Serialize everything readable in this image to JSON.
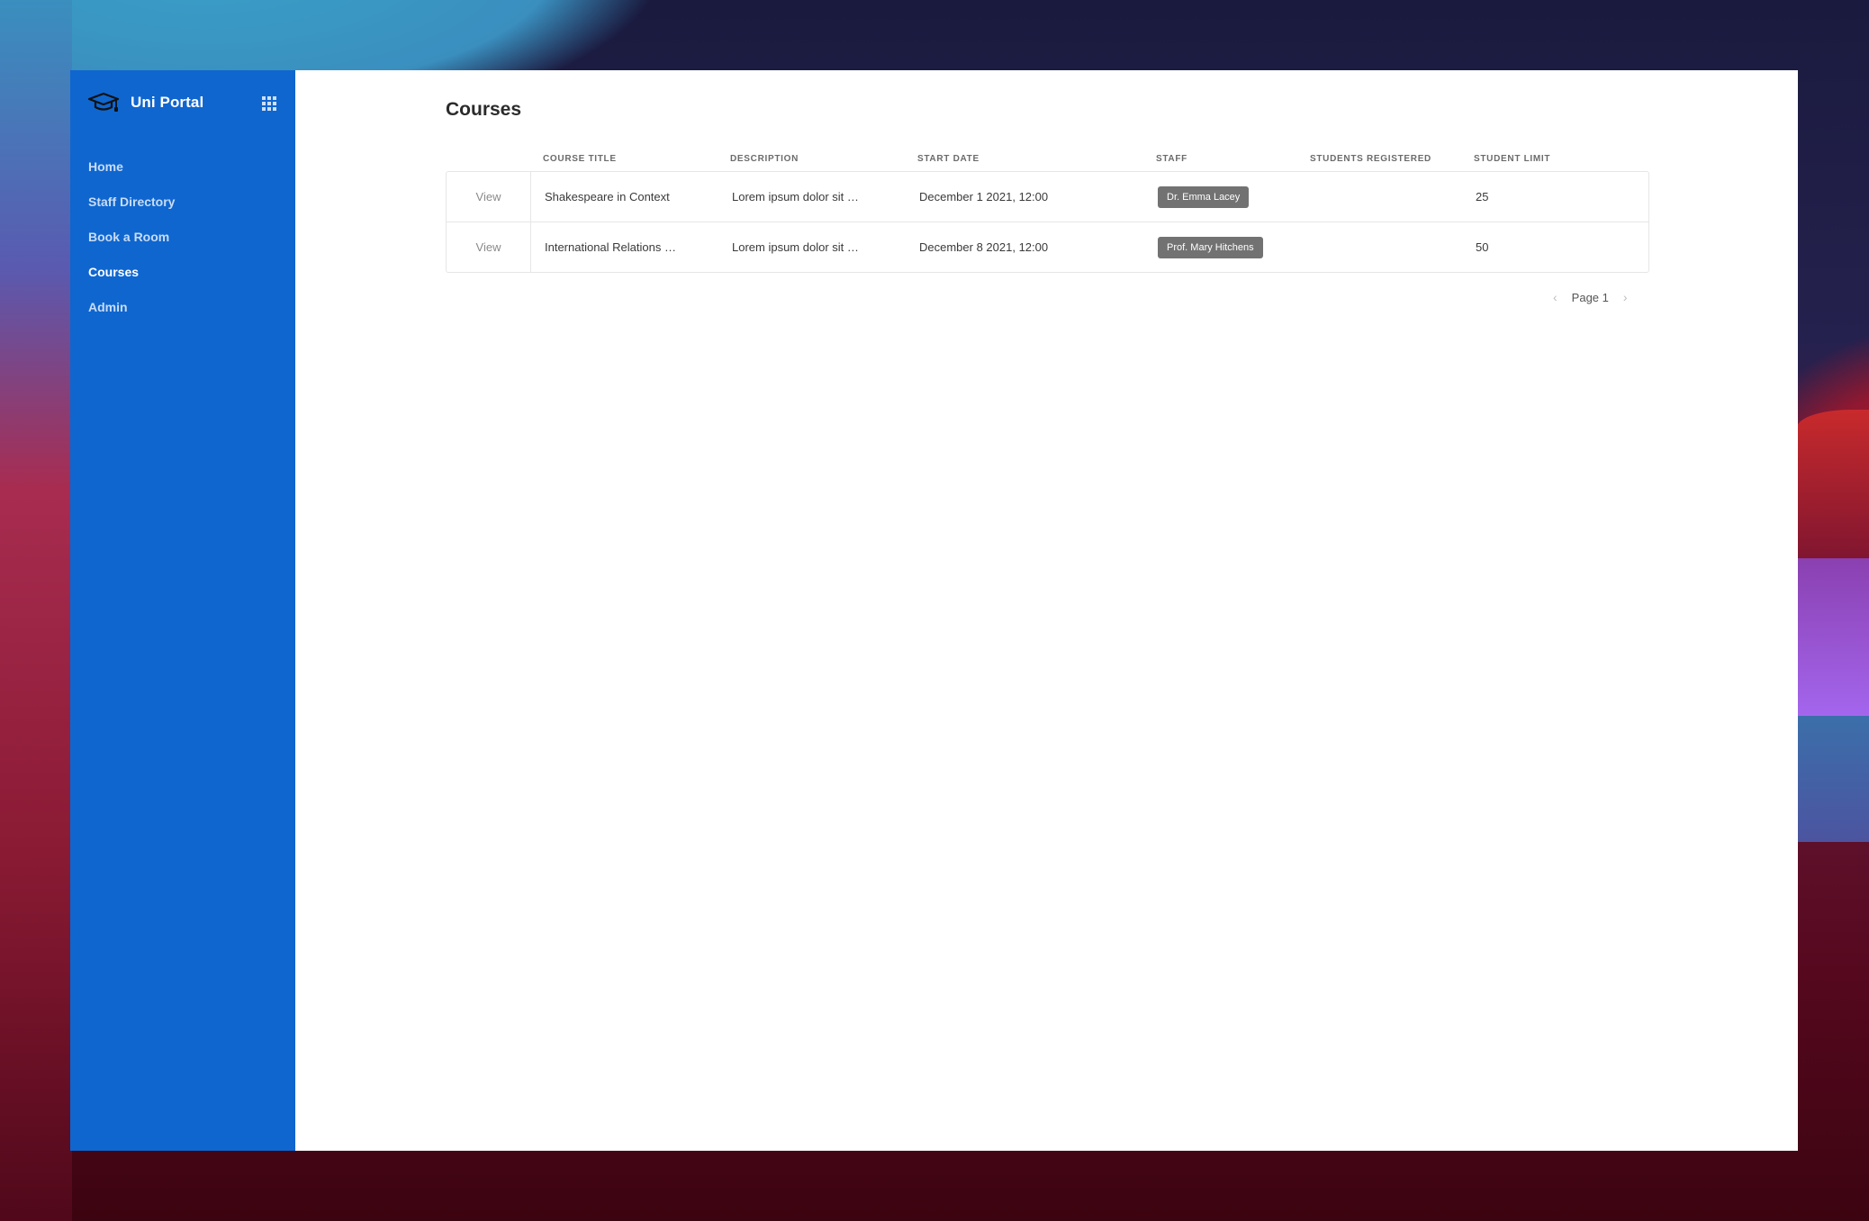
{
  "app": {
    "name": "Uni Portal",
    "logo_icon": "graduation-cap-icon",
    "apps_icon": "grid-apps-icon"
  },
  "colors": {
    "sidebar": "#0f66cf",
    "badge": "#727272"
  },
  "sidebar": {
    "items": [
      {
        "label": "Home",
        "active": false
      },
      {
        "label": "Staff Directory",
        "active": false
      },
      {
        "label": "Book a Room",
        "active": false
      },
      {
        "label": "Courses",
        "active": true
      },
      {
        "label": "Admin",
        "active": false
      }
    ]
  },
  "page": {
    "title": "Courses"
  },
  "table": {
    "columns": [
      "",
      "Course Title",
      "Description",
      "Start Date",
      "Staff",
      "Students Registered",
      "Student Limit"
    ],
    "rows": [
      {
        "action": "View",
        "title": "Shakespeare in Context",
        "description": "Lorem ipsum dolor sit …",
        "start_date": "December 1 2021, 12:00",
        "staff": "Dr. Emma Lacey",
        "students_registered": "",
        "student_limit": "25"
      },
      {
        "action": "View",
        "title": "International Relations …",
        "description": "Lorem ipsum dolor sit …",
        "start_date": "December 8 2021, 12:00",
        "staff": "Prof. Mary Hitchens",
        "students_registered": "",
        "student_limit": "50"
      }
    ]
  },
  "pagination": {
    "label": "Page 1",
    "prev_icon": "‹",
    "next_icon": "›"
  }
}
